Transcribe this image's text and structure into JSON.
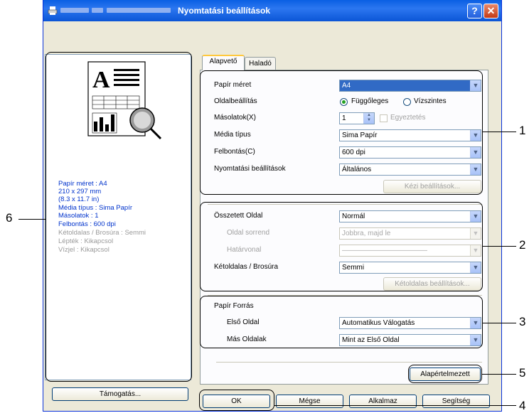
{
  "window": {
    "title": "Nyomtatási beállítások",
    "help_glyph": "?",
    "close_glyph": "✕"
  },
  "tabs": [
    "Alapvető",
    "Haladó"
  ],
  "preview_info": [
    {
      "text": "Papír méret : A4",
      "style": "blue"
    },
    {
      "text": "210 x 297 mm",
      "style": "blue"
    },
    {
      "text": "(8.3 x 11.7 in)",
      "style": "blue"
    },
    {
      "text": "Média típus : Sima Papír",
      "style": "blue"
    },
    {
      "text": "Másolatok : 1",
      "style": "blue"
    },
    {
      "text": "Felbontás : 600 dpi",
      "style": "blue"
    },
    {
      "text": "Kétoldalas / Brosúra : Semmi",
      "style": "gray"
    },
    {
      "text": "Lépték : Kikapcsol",
      "style": "gray"
    },
    {
      "text": "Vízjel : Kikapcsol",
      "style": "gray"
    }
  ],
  "paper": {
    "paper_size_label": "Papír méret",
    "paper_size_value": "A4",
    "orientation_label": "Oldalbeállítás",
    "portrait": "Függőleges",
    "landscape": "Vízszintes",
    "copies_label": "Másolatok(X)",
    "copies_value": "1",
    "collate": "Egyeztetés",
    "media_label": "Média típus",
    "media_value": "Sima Papír",
    "resolution_label": "Felbontás(C)",
    "resolution_value": "600 dpi",
    "print_settings_label": "Nyomtatási beállítások",
    "print_settings_value": "Általános",
    "manual_button": "Kézi beállítások..."
  },
  "layout": {
    "multipage_label": "Összetett Oldal",
    "multipage_value": "Normál",
    "page_order_label": "Oldal sorrend",
    "page_order_value": "Jobbra, majd le",
    "border_label": "Határvonal",
    "border_value": "————————————",
    "duplex_label": "Kétoldalas / Brosúra",
    "duplex_value": "Semmi",
    "duplex_button": "Kétoldalas beállítások..."
  },
  "source": {
    "title": "Papír Forrás",
    "first_label": "Első Oldal",
    "first_value": "Automatikus Válogatás",
    "other_label": "Más Oldalak",
    "other_value": "Mint az Első Oldal"
  },
  "buttons": {
    "default": "Alapértelmezett",
    "support": "Támogatás...",
    "ok": "OK",
    "cancel": "Mégse",
    "apply": "Alkalmaz",
    "help": "Segítség"
  },
  "callouts": [
    "1",
    "2",
    "3",
    "4",
    "5",
    "6"
  ]
}
